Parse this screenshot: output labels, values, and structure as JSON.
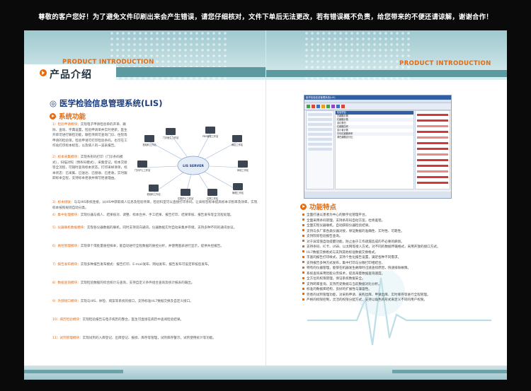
{
  "notice": "尊敬的客户您好！为了避免文件印刷出来会产生错误，请您仔细核对，文件下单后无法更改，若有错误概不负责，给您带来的不便还请谅解，谢谢合作！",
  "colors": {
    "accent": "#e46b12",
    "teal": "#5d9aa0",
    "title_blue": "#1d3d7c"
  },
  "header": {
    "en_left": "PRODUCT INTRODUCTION",
    "en_right": "PRODUCT INTRODUCTION",
    "zh_title": "产品介绍"
  },
  "left": {
    "system_title": "医学检验信息管理系统(LIS)",
    "section_title": "系统功能",
    "diagram": {
      "center": "LIS SERVER",
      "nodes": [
        "检验科工作站",
        "门诊医生工作站",
        "PDS管理工作站",
        "病区工作站",
        "门诊护士工作站",
        "体检工作站",
        "检验科工作站",
        "住院护士工作站",
        "住院工作站",
        "管理工作站",
        "主任工作站",
        "院长工作站",
        "病案工作站",
        "病区工作站"
      ]
    },
    "items": [
      {
        "num": "1）检验申请模块：",
        "text": "实现电子申请检验单的开单、删除、查询、字典设置，检验申请单并实时更新，医生开单可进行联检功能，联检项目可查询门诊、住院等申请的检验单。检验申请可打印检验条码，也可在工作站打印标本标签，以及病人的一览表报告。"
      },
      {
        "num": "2）标本采集模块：",
        "text": "实现条形码打印（门诊条码模式），扫描对照（预条码模式），采集登记，标本交接等全流程，可随时查询标本状态，打印采样清单，标本状态：已采集、已送达、已接收、已拒收，实时跟踪标本全程，支持标本拒收并填写拒收理由。"
      },
      {
        "num": "3）标本接收：",
        "text": "与与HIS系统连接，从HIS中获取病人信息及检验项目，检验科室可以直接打印条码，让采标签标本提高标本识别率及效率，实现标本按照规则自动分类。"
      },
      {
        "num": "4）集中处理模块：",
        "text": "实现仪器与病人、结果核对、调整、标本合并、手工结果、报告打印、结果审核、报告发布等全流程处理。"
      },
      {
        "num": "5）仪器联机数据模块：",
        "text": "实现各仪器数据的联机，同时支持双向通讯，仪器数据实时自动采集并存储，支持多种不同的通讯协议。"
      },
      {
        "num": "6）质控管理模块：",
        "text": "实现单个或批量质控样本，能自动进行全程数据的质控分析，并使用图表进行显示，提供失控报告。"
      },
      {
        "num": "7）报告发布模块：",
        "text": "实现多种报告发布模式：报告打印、E-mail发布、网站发布，报告发布可设定审核后发布。"
      },
      {
        "num": "8）数据查询模块：",
        "text": "实现检验数据的综合统计与查询，支持自定义条件组合查询及统计报表的输出。"
      },
      {
        "num": "9）外部接口模块：",
        "text": "实现与HIS、体检、病案等系统的接口，支持标准HL7数据交换及自定义接口。"
      },
      {
        "num": "10）病历检验模块：",
        "text": "实现检验报告与电子病历的整合，医生可直接在病历中查阅检验结果。"
      },
      {
        "num": "11）试剂管理模块：",
        "text": "实现试剂的入库登记、出库登记、报损、库存等管理，试剂库存警示，试剂使用统计等功能。"
      }
    ]
  },
  "right": {
    "screenshot": {
      "window_title": "医学检验信息管理系统(LIS)",
      "table_rows": [
        "检验项目",
        "白细胞计数",
        "红细胞计数",
        "血红蛋白",
        "红细胞压积",
        "血小板计数",
        "平均红细胞体积",
        "淋巴细胞百分比"
      ]
    },
    "section_title": "功能特点",
    "features": [
      "全面打通以患者为中心的数字化管理平台。",
      "全面采用条码管理，支持条形码自动方案，杜绝差错。",
      "全面实现仪器联机，自动获取仪器检验结果。",
      "支持与多厂家各类仪器对接，保证数据的准确性、实时性、可靠性。",
      "支持院际检验报告查询。",
      "对于异常值自动提醒功能，防止由于工作疏漏造成的不必要的麻烦。",
      "支持条码、IC卡、USB、以太网等接入方式，对不同的数据传输格式，采用开放的接口方式。",
      "HL7数据交换格式与支持其他标准数据交换格式。",
      "丰富的报告打印样式，支持个性化报告设置，满足各种不同需求。",
      "支持报告多种方式发布，集中打印与分散打印相结合。",
      "特有的仪器管理，能够在机器发生故障时迅速查找原因，快速排除故障。",
      "系统查询采用智能分页技术，提高海量数据查询速度。",
      "全方位的权限管理，保证系统数据安全。",
      "支持跨库查询，支持历史数据与当前数据对比分析。",
      "标准的数据库结构，良好的扩展性与兼容性。",
      "完善的试剂管理功能，对采购申请、采购出库、申请出库、实时库存等进行全程管理。",
      "严格的权限控制，灵活的权限分配方式，支持以角色的形式来定义不同的用户权限。"
    ]
  }
}
